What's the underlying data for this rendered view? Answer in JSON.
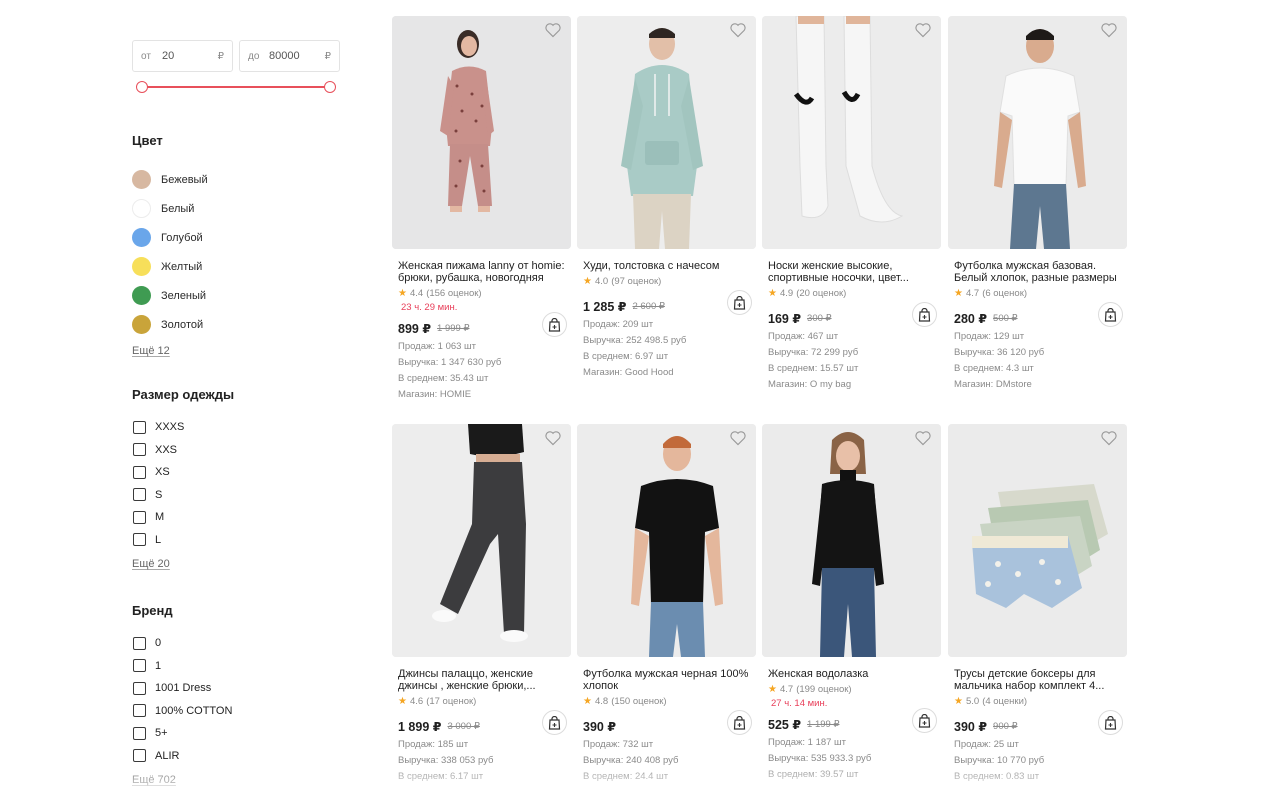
{
  "filters": {
    "price": {
      "from_prefix": "от",
      "from_value": "20",
      "to_prefix": "до",
      "to_value": "80000",
      "currency": "₽"
    },
    "color": {
      "title": "Цвет",
      "items": [
        {
          "label": "Бежевый",
          "swatch": "#d7b8a1"
        },
        {
          "label": "Белый",
          "swatch": "#ffffff"
        },
        {
          "label": "Голубой",
          "swatch": "#6aa6ea"
        },
        {
          "label": "Желтый",
          "swatch": "#f7df5a"
        },
        {
          "label": "Зеленый",
          "swatch": "#3f9b52"
        },
        {
          "label": "Золотой",
          "swatch": "#c9a43a"
        }
      ],
      "more": "Ещё 12"
    },
    "size": {
      "title": "Размер одежды",
      "items": [
        "XXXS",
        "XXS",
        "XS",
        "S",
        "M",
        "L"
      ],
      "more": "Ещё 20"
    },
    "brand": {
      "title": "Бренд",
      "items": [
        "0",
        "1",
        "1001 Dress",
        "100% COTTON",
        "5+",
        "ALIR"
      ],
      "more": "Ещё 702"
    }
  },
  "products": [
    {
      "title": "Женская пижама lanny от homie: брюки, рубашка, новогодняя",
      "rating": "4.4",
      "reviews": "(156 оценок)",
      "timer": "23 ч. 29 мин.",
      "price": "899 ₽",
      "old_price": "1 999 ₽",
      "stats": [
        "Продаж: 1 063 шт",
        "Выручка: 1 347 630 руб",
        "В среднем: 35.43 шт",
        "Магазин: HOMIE"
      ],
      "photo": "pajama"
    },
    {
      "title": "Худи, толстовка с начесом",
      "rating": "4.0",
      "reviews": "(97 оценок)",
      "timer": "",
      "price": "1 285 ₽",
      "old_price": "2 600 ₽",
      "stats": [
        "Продаж: 209 шт",
        "Выручка: 252 498.5 руб",
        "В среднем: 6.97 шт",
        "Магазин: Good Hood"
      ],
      "photo": "hoodie"
    },
    {
      "title": "Носки женские высокие, спортивные носочки, цвет...",
      "rating": "4.9",
      "reviews": "(20 оценок)",
      "timer": "",
      "price": "169 ₽",
      "old_price": "300 ₽",
      "stats": [
        "Продаж: 467 шт",
        "Выручка: 72 299 руб",
        "В среднем: 15.57 шт",
        "Магазин: O my bag"
      ],
      "photo": "socks"
    },
    {
      "title": "Футболка мужская базовая. Белый хлопок, разные размеры",
      "rating": "4.7",
      "reviews": "(6 оценок)",
      "timer": "",
      "price": "280 ₽",
      "old_price": "500 ₽",
      "stats": [
        "Продаж: 129 шт",
        "Выручка: 36 120 руб",
        "В среднем: 4.3 шт",
        "Магазин: DMstore"
      ],
      "photo": "white-tee"
    },
    {
      "title": "Джинсы палаццо, женские джинсы , женские брюки,...",
      "rating": "4.6",
      "reviews": "(17 оценок)",
      "timer": "",
      "price": "1 899 ₽",
      "old_price": "3 000 ₽",
      "stats": [
        "Продаж: 185 шт",
        "Выручка: 338 053 руб",
        "В среднем: 6.17 шт"
      ],
      "photo": "jeans"
    },
    {
      "title": "Футболка мужская черная 100% хлопок",
      "rating": "4.8",
      "reviews": "(150 оценок)",
      "timer": "",
      "price": "390 ₽",
      "old_price": "",
      "stats": [
        "Продаж: 732 шт",
        "Выручка: 240 408 руб",
        "В среднем: 24.4 шт"
      ],
      "photo": "black-tee"
    },
    {
      "title": "Женская водолазка",
      "rating": "4.7",
      "reviews": "(199 оценок)",
      "timer": "27 ч. 14 мин.",
      "price": "525 ₽",
      "old_price": "1 199 ₽",
      "stats": [
        "Продаж: 1 187 шт",
        "Выручка: 535 933.3 руб",
        "В среднем: 39.57 шт"
      ],
      "photo": "turtleneck"
    },
    {
      "title": "Трусы детские боксеры для мальчика набор комплект 4...",
      "rating": "5.0",
      "reviews": "(4 оценки)",
      "timer": "",
      "price": "390 ₽",
      "old_price": "900 ₽",
      "stats": [
        "Продаж: 25 шт",
        "Выручка: 10 770 руб",
        "В среднем: 0.83 шт"
      ],
      "photo": "boxers"
    }
  ]
}
